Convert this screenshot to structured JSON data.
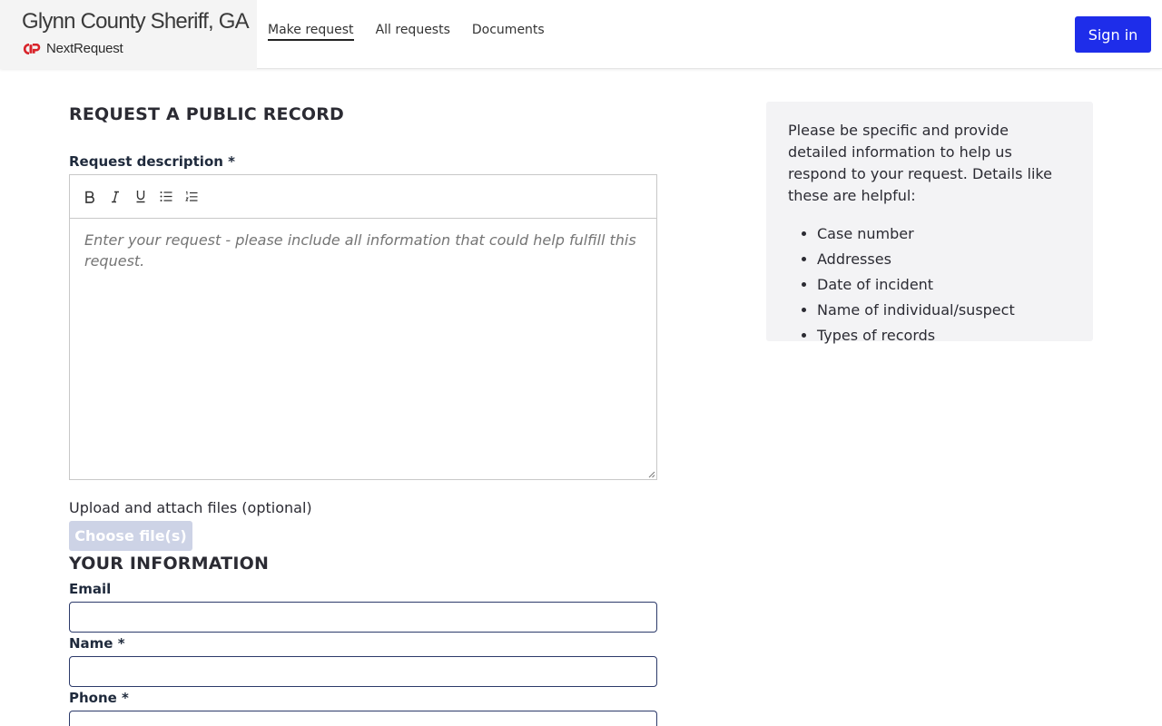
{
  "header": {
    "agency": "Glynn County Sheriff, GA",
    "product": "NextRequest",
    "nav": [
      {
        "label": "Make request",
        "active": true
      },
      {
        "label": "All requests",
        "active": false
      },
      {
        "label": "Documents",
        "active": false
      }
    ],
    "signin_label": "Sign in"
  },
  "form": {
    "title": "REQUEST A PUBLIC RECORD",
    "description_label": "Request description *",
    "toolbar_icons": [
      "bold-icon",
      "italic-icon",
      "underline-icon",
      "bulleted-list-icon",
      "numbered-list-icon"
    ],
    "description_placeholder": "Enter your request - please include all information that could help fulfill this request.",
    "upload_label": "Upload and attach files (optional)",
    "choose_files_label": "Choose file(s)",
    "your_info_title": "YOUR INFORMATION",
    "email_label": "Email",
    "email_value": "",
    "name_label": "Name *",
    "name_value": "",
    "phone_label": "Phone *",
    "phone_value": ""
  },
  "help": {
    "text": "Please be specific and provide detailed information to help us respond to your request. Details like these are helpful:",
    "items": [
      "Case number",
      "Addresses",
      "Date of incident",
      "Name of individual/suspect",
      "Types of records"
    ]
  },
  "colors": {
    "primary": "#1e2dea",
    "disabled_button": "#cdd3e6",
    "help_bg": "#f3f3f5",
    "brand_red": "#d8232a"
  }
}
